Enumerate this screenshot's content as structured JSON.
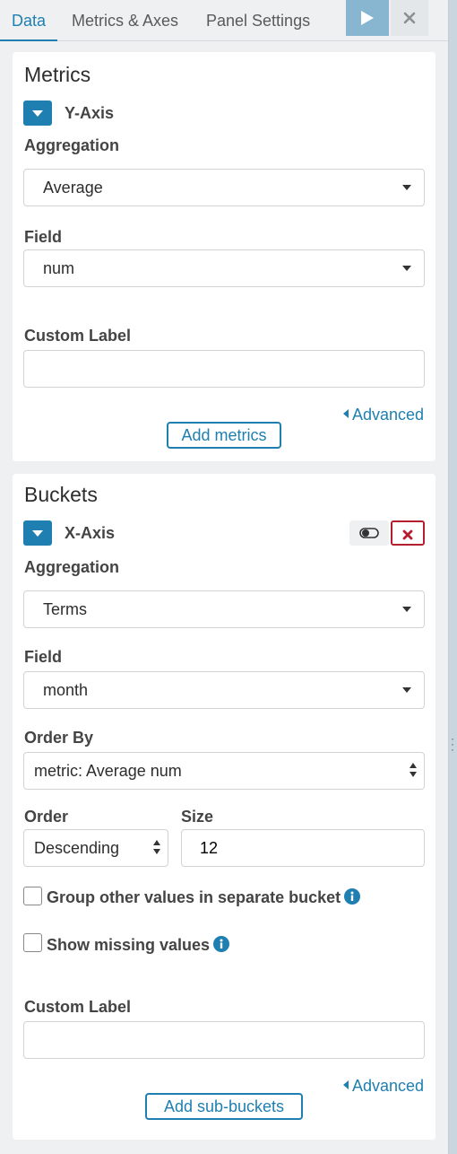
{
  "tabs": [
    {
      "label": "Data"
    },
    {
      "label": "Metrics & Axes"
    },
    {
      "label": "Panel Settings"
    }
  ],
  "metrics": {
    "title": "Metrics",
    "agg_name": "Y-Axis",
    "aggregation_label": "Aggregation",
    "aggregation_value": "Average",
    "field_label": "Field",
    "field_value": "num",
    "custom_label_label": "Custom Label",
    "custom_label_value": "",
    "advanced": "Advanced",
    "add_button": "Add metrics"
  },
  "buckets": {
    "title": "Buckets",
    "agg_name": "X-Axis",
    "aggregation_label": "Aggregation",
    "aggregation_value": "Terms",
    "field_label": "Field",
    "field_value": "month",
    "order_by_label": "Order By",
    "order_by_value": "metric: Average num",
    "order_label": "Order",
    "order_value": "Descending",
    "size_label": "Size",
    "size_value": "12",
    "group_other_label": "Group other values in separate bucket",
    "show_missing_label": "Show missing values",
    "custom_label_label": "Custom Label",
    "custom_label_value": "",
    "advanced": "Advanced",
    "add_button": "Add sub-buckets"
  },
  "colors": {
    "accent": "#1f7fb0",
    "play_button": "#88b5cf",
    "danger": "#b31f2f"
  },
  "icons": {
    "play": "play-icon",
    "close": "close-icon",
    "collapse": "chevron-down-icon",
    "advanced": "caret-left-icon",
    "info": "info-icon",
    "toggle": "toggle-icon",
    "remove": "x-icon"
  }
}
